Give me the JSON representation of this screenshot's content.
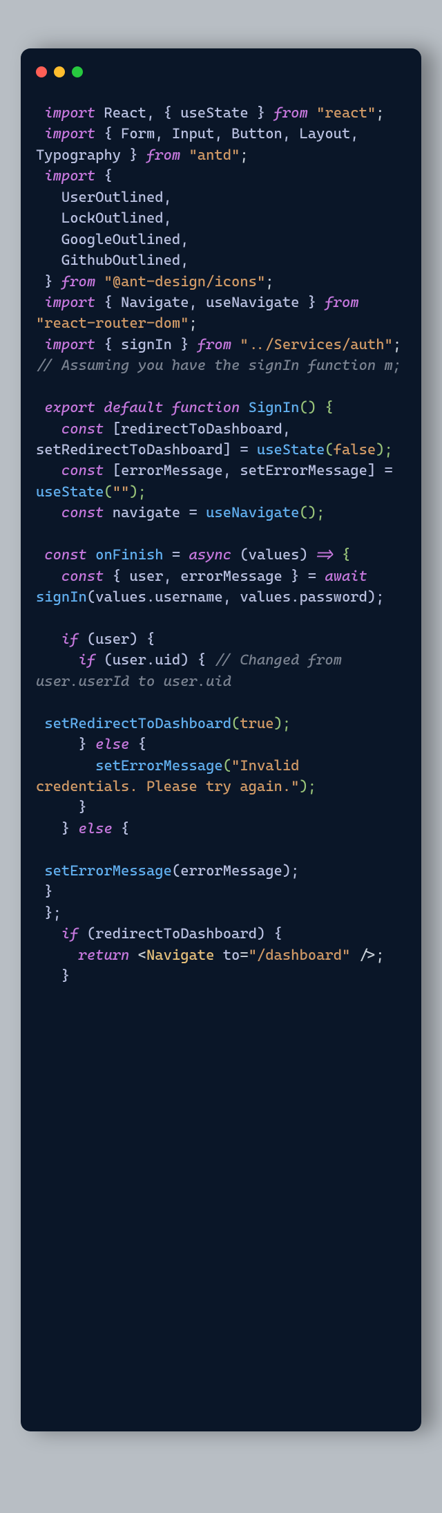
{
  "code": {
    "tokens": [
      {
        "text": " ",
        "cls": ""
      },
      {
        "text": "import",
        "cls": "kw"
      },
      {
        "text": " React, { useState } ",
        "cls": "id"
      },
      {
        "text": "from",
        "cls": "kw"
      },
      {
        "text": " ",
        "cls": ""
      },
      {
        "text": "\"react\"",
        "cls": "str"
      },
      {
        "text": ";",
        "cls": "op"
      },
      {
        "text": "\n",
        "cls": ""
      },
      {
        "text": " ",
        "cls": ""
      },
      {
        "text": "import",
        "cls": "kw"
      },
      {
        "text": " { Form, Input, Button, Layout, Typography } ",
        "cls": "id"
      },
      {
        "text": "from",
        "cls": "kw"
      },
      {
        "text": " ",
        "cls": ""
      },
      {
        "text": "\"antd\"",
        "cls": "str"
      },
      {
        "text": ";",
        "cls": "op"
      },
      {
        "text": "\n",
        "cls": ""
      },
      {
        "text": " ",
        "cls": ""
      },
      {
        "text": "import",
        "cls": "kw"
      },
      {
        "text": " {",
        "cls": "id"
      },
      {
        "text": "\n",
        "cls": ""
      },
      {
        "text": "   UserOutlined,",
        "cls": "id"
      },
      {
        "text": "\n",
        "cls": ""
      },
      {
        "text": "   LockOutlined,",
        "cls": "id"
      },
      {
        "text": "\n",
        "cls": ""
      },
      {
        "text": "   GoogleOutlined,",
        "cls": "id"
      },
      {
        "text": "\n",
        "cls": ""
      },
      {
        "text": "   GithubOutlined,",
        "cls": "id"
      },
      {
        "text": "\n",
        "cls": ""
      },
      {
        "text": " } ",
        "cls": "id"
      },
      {
        "text": "from",
        "cls": "kw"
      },
      {
        "text": " ",
        "cls": ""
      },
      {
        "text": "\"@ant-design/icons\"",
        "cls": "str"
      },
      {
        "text": ";",
        "cls": "op"
      },
      {
        "text": "\n",
        "cls": ""
      },
      {
        "text": " ",
        "cls": ""
      },
      {
        "text": "import",
        "cls": "kw"
      },
      {
        "text": " { Navigate, useNavigate } ",
        "cls": "id"
      },
      {
        "text": "from",
        "cls": "kw"
      },
      {
        "text": " ",
        "cls": ""
      },
      {
        "text": "\"react-router-dom\"",
        "cls": "str"
      },
      {
        "text": ";",
        "cls": "op"
      },
      {
        "text": "\n",
        "cls": ""
      },
      {
        "text": " ",
        "cls": ""
      },
      {
        "text": "import",
        "cls": "kw"
      },
      {
        "text": " { signIn } ",
        "cls": "id"
      },
      {
        "text": "from",
        "cls": "kw"
      },
      {
        "text": " ",
        "cls": ""
      },
      {
        "text": "\"../Services/auth\"",
        "cls": "str"
      },
      {
        "text": "; ",
        "cls": "op"
      },
      {
        "text": "// Assuming you have the signIn function m;",
        "cls": "cm"
      },
      {
        "text": "\n",
        "cls": ""
      },
      {
        "text": "\n",
        "cls": ""
      },
      {
        "text": " ",
        "cls": ""
      },
      {
        "text": "export default function",
        "cls": "kw"
      },
      {
        "text": " ",
        "cls": ""
      },
      {
        "text": "SignIn",
        "cls": "fn"
      },
      {
        "text": "() {",
        "cls": "pn"
      },
      {
        "text": "\n",
        "cls": ""
      },
      {
        "text": "   ",
        "cls": ""
      },
      {
        "text": "const",
        "cls": "kw"
      },
      {
        "text": " [redirectToDashboard, setRedirectToDashboard] = ",
        "cls": "id"
      },
      {
        "text": "useState",
        "cls": "fn"
      },
      {
        "text": "(",
        "cls": "pn"
      },
      {
        "text": "false",
        "cls": "bool"
      },
      {
        "text": ");",
        "cls": "pn"
      },
      {
        "text": "\n",
        "cls": ""
      },
      {
        "text": "   ",
        "cls": ""
      },
      {
        "text": "const",
        "cls": "kw"
      },
      {
        "text": " [errorMessage, setErrorMessage] = ",
        "cls": "id"
      },
      {
        "text": "useState",
        "cls": "fn"
      },
      {
        "text": "(",
        "cls": "pn"
      },
      {
        "text": "\"\"",
        "cls": "str"
      },
      {
        "text": ");",
        "cls": "pn"
      },
      {
        "text": "\n",
        "cls": ""
      },
      {
        "text": "   ",
        "cls": ""
      },
      {
        "text": "const",
        "cls": "kw"
      },
      {
        "text": " navigate = ",
        "cls": "id"
      },
      {
        "text": "useNavigate",
        "cls": "fn"
      },
      {
        "text": "();",
        "cls": "pn"
      },
      {
        "text": "\n",
        "cls": ""
      },
      {
        "text": "\n",
        "cls": ""
      },
      {
        "text": " ",
        "cls": ""
      },
      {
        "text": "const",
        "cls": "kw"
      },
      {
        "text": " ",
        "cls": ""
      },
      {
        "text": "onFinish",
        "cls": "fn"
      },
      {
        "text": " = ",
        "cls": "id"
      },
      {
        "text": "async",
        "cls": "kw"
      },
      {
        "text": " (values) ",
        "cls": "id"
      },
      {
        "text": "=>",
        "cls": "kw"
      },
      {
        "text": " {",
        "cls": "pn"
      },
      {
        "text": "\n",
        "cls": ""
      },
      {
        "text": "   ",
        "cls": ""
      },
      {
        "text": "const",
        "cls": "kw"
      },
      {
        "text": " { user, errorMessage } = ",
        "cls": "id"
      },
      {
        "text": "await",
        "cls": "kw"
      },
      {
        "text": " ",
        "cls": ""
      },
      {
        "text": "signIn",
        "cls": "fn"
      },
      {
        "text": "(values.username, values.password);",
        "cls": "id"
      },
      {
        "text": "\n",
        "cls": ""
      },
      {
        "text": "\n",
        "cls": ""
      },
      {
        "text": "   ",
        "cls": ""
      },
      {
        "text": "if",
        "cls": "kw"
      },
      {
        "text": " (user) {",
        "cls": "id"
      },
      {
        "text": "\n",
        "cls": ""
      },
      {
        "text": "     ",
        "cls": ""
      },
      {
        "text": "if",
        "cls": "kw"
      },
      {
        "text": " (user.uid) { ",
        "cls": "id"
      },
      {
        "text": "// Changed from user.userId to user.uid",
        "cls": "cm"
      },
      {
        "text": "\n",
        "cls": ""
      },
      {
        "text": "\n",
        "cls": ""
      },
      {
        "text": " ",
        "cls": ""
      },
      {
        "text": "setRedirectToDashboard",
        "cls": "fn"
      },
      {
        "text": "(",
        "cls": "pn"
      },
      {
        "text": "true",
        "cls": "bool"
      },
      {
        "text": ");",
        "cls": "pn"
      },
      {
        "text": "\n",
        "cls": ""
      },
      {
        "text": "     } ",
        "cls": "id"
      },
      {
        "text": "else",
        "cls": "kw"
      },
      {
        "text": " {",
        "cls": "id"
      },
      {
        "text": "\n",
        "cls": ""
      },
      {
        "text": "       ",
        "cls": ""
      },
      {
        "text": "setErrorMessage",
        "cls": "fn"
      },
      {
        "text": "(",
        "cls": "pn"
      },
      {
        "text": "\"Invalid credentials. Please try again.\"",
        "cls": "str"
      },
      {
        "text": ");",
        "cls": "pn"
      },
      {
        "text": "\n",
        "cls": ""
      },
      {
        "text": "     }",
        "cls": "id"
      },
      {
        "text": "\n",
        "cls": ""
      },
      {
        "text": "   } ",
        "cls": "id"
      },
      {
        "text": "else",
        "cls": "kw"
      },
      {
        "text": " {",
        "cls": "id"
      },
      {
        "text": "\n",
        "cls": ""
      },
      {
        "text": "\n",
        "cls": ""
      },
      {
        "text": " ",
        "cls": ""
      },
      {
        "text": "setErrorMessage",
        "cls": "fn"
      },
      {
        "text": "(errorMessage);",
        "cls": "id"
      },
      {
        "text": "\n",
        "cls": ""
      },
      {
        "text": " }",
        "cls": "id"
      },
      {
        "text": "\n",
        "cls": ""
      },
      {
        "text": " };",
        "cls": "id"
      },
      {
        "text": "\n",
        "cls": ""
      },
      {
        "text": "   ",
        "cls": ""
      },
      {
        "text": "if",
        "cls": "kw"
      },
      {
        "text": " (redirectToDashboard) {",
        "cls": "id"
      },
      {
        "text": "\n",
        "cls": ""
      },
      {
        "text": "     ",
        "cls": ""
      },
      {
        "text": "return",
        "cls": "kw"
      },
      {
        "text": " <",
        "cls": "op"
      },
      {
        "text": "Navigate",
        "cls": "cl"
      },
      {
        "text": " ",
        "cls": ""
      },
      {
        "text": "to",
        "cls": "id"
      },
      {
        "text": "=",
        "cls": "op"
      },
      {
        "text": "\"/dashboard\"",
        "cls": "str"
      },
      {
        "text": " />;",
        "cls": "op"
      },
      {
        "text": "\n",
        "cls": ""
      },
      {
        "text": "   }",
        "cls": "id"
      }
    ]
  }
}
